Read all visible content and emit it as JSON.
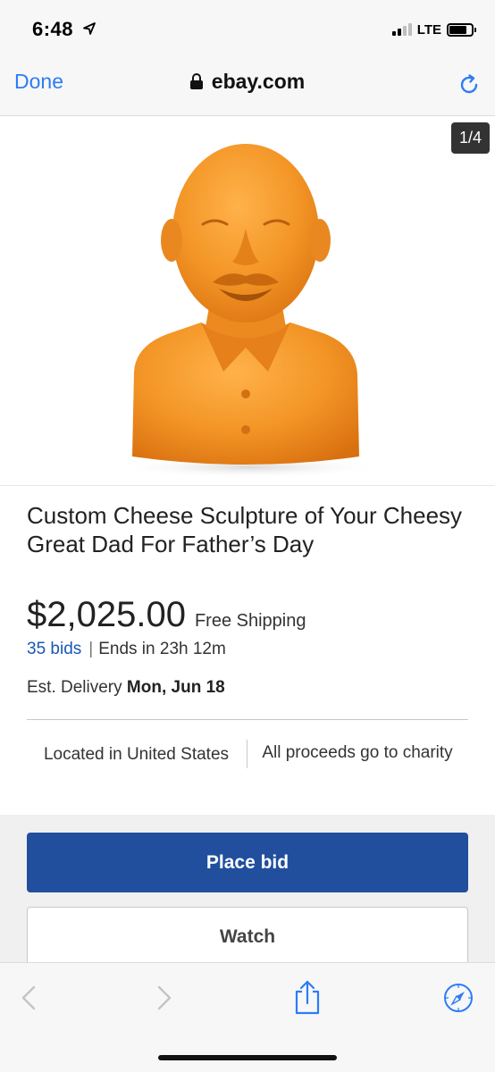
{
  "status_bar": {
    "time": "6:48",
    "network": "LTE",
    "icons": [
      "location-arrow-icon",
      "signal-icon",
      "battery-icon"
    ]
  },
  "browser": {
    "done_label": "Done",
    "url": "ebay.com",
    "accent_color": "#2d7cf6",
    "icons": [
      "lock-icon",
      "reload-icon"
    ]
  },
  "listing": {
    "image_counter": "1/4",
    "title": "Custom Cheese Sculpture of Your Cheesy Great Dad For Father’s Day",
    "price": "$2,025.00",
    "shipping": "Free Shipping",
    "bids": "35 bids",
    "ends": "Ends in 23h 12m",
    "delivery_label": "Est. Delivery",
    "delivery_date": "Mon, Jun 18",
    "location": "Located in United States",
    "charity": "All proceeds go to charity"
  },
  "actions": {
    "place_bid_label": "Place bid",
    "watch_label": "Watch",
    "place_bid_color": "#214f9e"
  },
  "toolbar": {
    "icons": [
      "back-icon",
      "forward-icon",
      "share-icon",
      "compass-icon"
    ]
  }
}
